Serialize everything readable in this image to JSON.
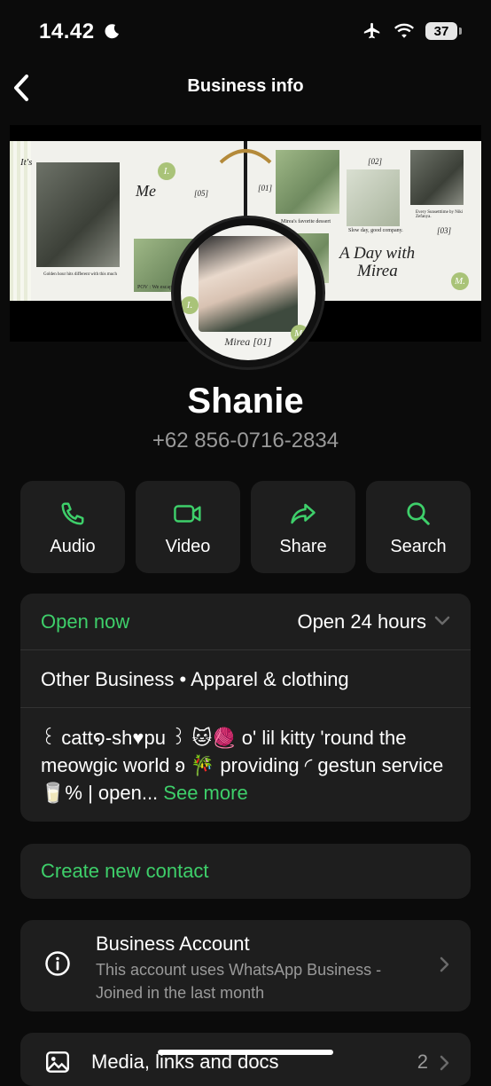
{
  "status_bar": {
    "time": "14.42",
    "battery": "37"
  },
  "nav": {
    "title": "Business info"
  },
  "cover": {
    "texts": [
      "It's",
      "Me",
      "[05]",
      "[01]",
      "Mirea's favorite dessert",
      "[02]",
      "Slow day, good company.",
      "Every Sunsetttime by Niki Zefanya.",
      "[03]",
      "A Day with",
      "Mirea",
      "Golden hour hits different with this much",
      "POV : We escape",
      "I.",
      "M.",
      "Mirea [01]"
    ]
  },
  "profile": {
    "name": "Shanie",
    "phone": "+62 856-0716-2834"
  },
  "actions": [
    {
      "label": "Audio",
      "icon": "phone-icon"
    },
    {
      "label": "Video",
      "icon": "video-icon"
    },
    {
      "label": "Share",
      "icon": "share-icon"
    },
    {
      "label": "Search",
      "icon": "search-icon"
    }
  ],
  "business": {
    "open_status": "Open now",
    "hours": "Open 24 hours",
    "category": "Other Business • Apparel & clothing",
    "description": "꒰ catt໑-sh♥︎pu ꒱ 🐱🧶 o' lil kitty 'round the meowgic world ʚ 🎋 providing ◜ gestun service 🥛% | open...",
    "see_more": "See more"
  },
  "create_contact": "Create new contact",
  "business_account": {
    "title": "Business Account",
    "subtitle": "This account uses WhatsApp Business - Joined in the last month"
  },
  "media": {
    "label": "Media, links and docs",
    "count": "2"
  },
  "colors": {
    "accent": "#3ecf6a",
    "card": "#1e1e1e",
    "background": "#0b0b0b"
  }
}
